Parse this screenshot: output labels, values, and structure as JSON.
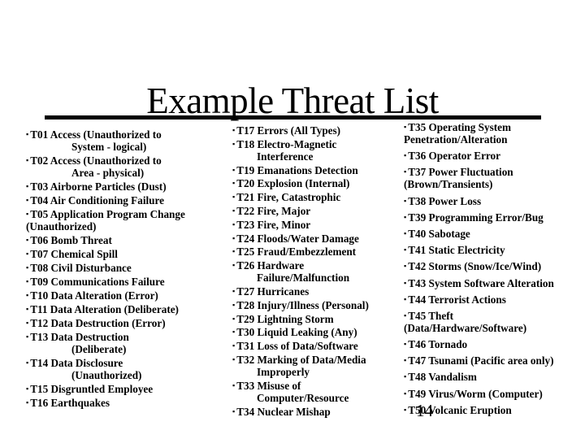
{
  "slide": {
    "title": "Example Threat List",
    "slide_number": "14",
    "bullet_glyph": "▪",
    "columns": [
      {
        "items": [
          {
            "first": "T01 Access (Unauthorized to",
            "cont": "System - logical)",
            "cont_style": "indent"
          },
          {
            "first": "T02 Access (Unauthorized to",
            "cont": "Area - physical)",
            "cont_style": "indent"
          },
          {
            "first": "T03 Airborne Particles (Dust)",
            "cont": null
          },
          {
            "first": "T04 Air Conditioning Failure",
            "cont": null
          },
          {
            "first": "T05 Application Program Change",
            "cont": "(Unauthorized)",
            "cont_style": "flush"
          },
          {
            "first": "T06 Bomb Threat",
            "cont": null
          },
          {
            "first": "T07 Chemical Spill",
            "cont": null
          },
          {
            "first": "T08 Civil Disturbance",
            "cont": null
          },
          {
            "first": "T09 Communications Failure",
            "cont": null
          },
          {
            "first": "T10 Data Alteration (Error)",
            "cont": null
          },
          {
            "first": "T11 Data Alteration (Deliberate)",
            "cont": null
          },
          {
            "first": "T12 Data Destruction (Error)",
            "cont": null
          },
          {
            "first": "T13 Data Destruction",
            "cont": "(Deliberate)",
            "cont_style": "indent"
          },
          {
            "first": "T14 Data Disclosure",
            "cont": "(Unauthorized)",
            "cont_style": "indent"
          },
          {
            "first": "T15 Disgruntled Employee",
            "cont": null
          },
          {
            "first": "T16 Earthquakes",
            "cont": null
          }
        ]
      },
      {
        "items": [
          {
            "first": "T17 Errors (All Types)",
            "cont": null
          },
          {
            "first": "T18 Electro-Magnetic",
            "cont": "Interference",
            "cont_style": "indent"
          },
          {
            "first": "T19 Emanations Detection",
            "cont": null
          },
          {
            "first": "T20 Explosion (Internal)",
            "cont": null
          },
          {
            "first": "T21 Fire, Catastrophic",
            "cont": null
          },
          {
            "first": "T22 Fire, Major",
            "cont": null
          },
          {
            "first": "T23 Fire, Minor",
            "cont": null
          },
          {
            "first": "T24 Floods/Water Damage",
            "cont": null
          },
          {
            "first": "T25 Fraud/Embezzlement",
            "cont": null
          },
          {
            "first": "T26 Hardware",
            "cont": "Failure/Malfunction",
            "cont_style": "indent"
          },
          {
            "first": "T27 Hurricanes",
            "cont": null
          },
          {
            "first": "T28 Injury/Illness (Personal)",
            "cont": null
          },
          {
            "first": "T29 Lightning Storm",
            "cont": null
          },
          {
            "first": "T30 Liquid Leaking (Any)",
            "cont": null
          },
          {
            "first": "T31 Loss of Data/Software",
            "cont": null
          },
          {
            "first": "T32 Marking of Data/Media",
            "cont": "Improperly",
            "cont_style": "indent"
          },
          {
            "first": "T33 Misuse of",
            "cont": "Computer/Resource",
            "cont_style": "indent"
          },
          {
            "first": "T34 Nuclear Mishap",
            "cont": null
          }
        ]
      },
      {
        "items": [
          {
            "first": "T35 Operating System",
            "cont": "Penetration/Alteration",
            "cont_style": "flush"
          },
          {
            "first": "T36 Operator Error",
            "cont": null
          },
          {
            "first": "T37 Power Fluctuation",
            "cont": "(Brown/Transients)",
            "cont_style": "flush"
          },
          {
            "first": "T38 Power Loss",
            "cont": null
          },
          {
            "first": "T39 Programming Error/Bug",
            "cont": null
          },
          {
            "first": "T40 Sabotage",
            "cont": null
          },
          {
            "first": "T41 Static Electricity",
            "cont": null
          },
          {
            "first": "T42 Storms (Snow/Ice/Wind)",
            "cont": null
          },
          {
            "first": "T43 System Software Alteration",
            "cont": null
          },
          {
            "first": "T44 Terrorist Actions",
            "cont": null
          },
          {
            "first": "T45 Theft",
            "cont": "(Data/Hardware/Software)",
            "cont_style": "flush"
          },
          {
            "first": "T46 Tornado",
            "cont": null
          },
          {
            "first": "T47 Tsunami (Pacific area only)",
            "cont": null
          },
          {
            "first": "T48 Vandalism",
            "cont": null
          },
          {
            "first": "T49 Virus/Worm (Computer)",
            "cont": null
          },
          {
            "first": "T50 Volcanic Eruption",
            "cont": null
          }
        ]
      }
    ]
  }
}
